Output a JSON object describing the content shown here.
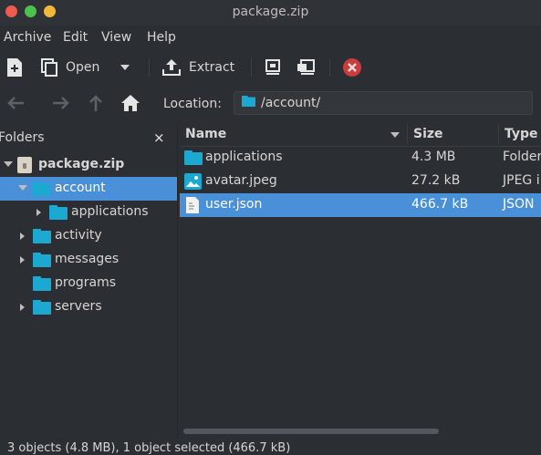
{
  "window": {
    "title": "package.zip"
  },
  "menubar": {
    "items": [
      "Archive",
      "Edit",
      "View",
      "Help"
    ]
  },
  "toolbar": {
    "open_label": "Open",
    "extract_label": "Extract"
  },
  "location": {
    "label": "Location:",
    "path": "/account/"
  },
  "sidebar": {
    "title": "Folders",
    "close_glyph": "×",
    "tree": [
      {
        "label": "package.zip",
        "expanded": true,
        "selected": false
      },
      {
        "label": "account",
        "expanded": true,
        "selected": true
      },
      {
        "label": "applications",
        "expanded": false,
        "selected": false
      },
      {
        "label": "activity",
        "expanded": false,
        "selected": false
      },
      {
        "label": "messages",
        "expanded": false,
        "selected": false
      },
      {
        "label": "programs",
        "expanded": false,
        "selected": false
      },
      {
        "label": "servers",
        "expanded": false,
        "selected": false
      }
    ]
  },
  "files": {
    "columns": [
      "Name",
      "Size",
      "Type"
    ],
    "rows": [
      {
        "name": "applications",
        "size": "4.3 MB",
        "type": "Folder",
        "icon": "folder-icon",
        "selected": false
      },
      {
        "name": "avatar.jpeg",
        "size": "27.2 kB",
        "type": "JPEG i",
        "icon": "image-file-icon",
        "selected": false
      },
      {
        "name": "user.json",
        "size": "466.7 kB",
        "type": "JSON",
        "icon": "text-file-icon",
        "selected": true
      }
    ]
  },
  "status": {
    "text": "3 objects (4.8 MB), 1 object selected (466.7 kB)"
  },
  "colors": {
    "accent": "#4a90d9",
    "folder": "#1ba9d1",
    "background": "#2b2e33"
  }
}
